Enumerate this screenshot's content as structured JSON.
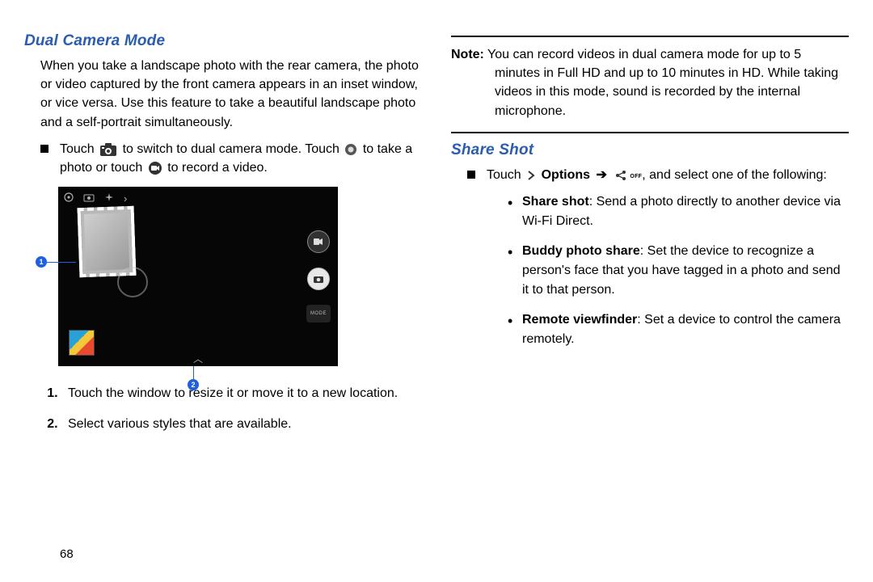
{
  "left": {
    "heading": "Dual Camera Mode",
    "intro": "When you take a landscape photo with the rear camera, the photo or video captured by the front camera appears in an inset window, or vice versa. Use this feature to take a beautiful landscape photo and a self-portrait simultaneously.",
    "bullet_pre": "Touch",
    "bullet_mid1": "to switch to dual camera mode. Touch",
    "bullet_mid2": "to take a photo or touch",
    "bullet_post": "to record a video.",
    "steps": [
      "Touch the window to resize it or move it to a new location.",
      "Select various styles that are available."
    ],
    "callout1": "1",
    "callout2": "2",
    "mode_label": "MODE"
  },
  "right": {
    "note_label": "Note:",
    "note_text": "You can record videos in dual camera mode for up to 5 minutes in Full HD and up to 10 minutes in HD. While taking videos in this mode, sound is recorded by the internal microphone.",
    "heading": "Share Shot",
    "bullet_touch": "Touch",
    "bullet_options": "Options",
    "bullet_tail": ", and select one of the following:",
    "off": "OFF",
    "items": [
      {
        "term": "Share shot",
        "desc": ": Send a photo directly to another device via Wi-Fi Direct."
      },
      {
        "term": "Buddy photo share",
        "desc": ": Set the device to recognize a person's face that you have tagged in a photo and send it to that person."
      },
      {
        "term": "Remote viewfinder",
        "desc": ": Set a device to control the camera remotely."
      }
    ]
  },
  "page_number": "68"
}
